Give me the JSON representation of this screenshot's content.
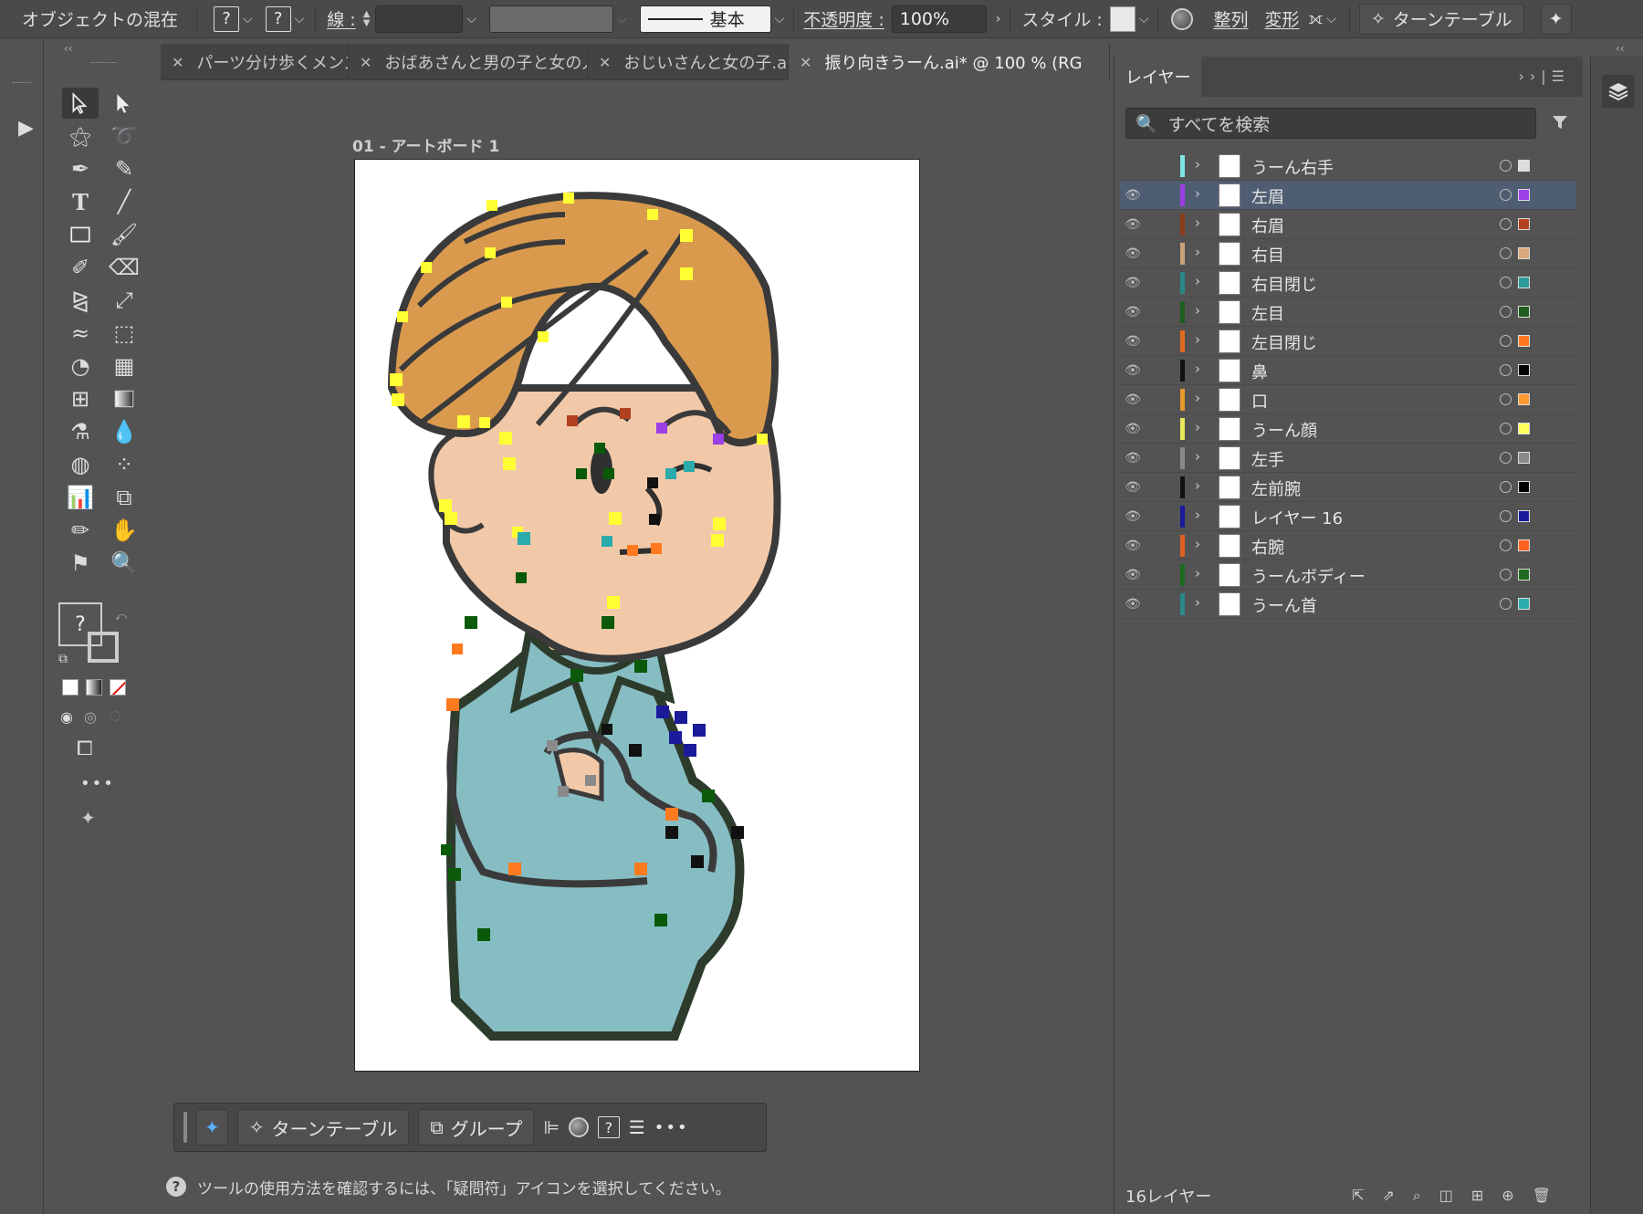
{
  "control_bar": {
    "title": "オブジェクトの混在",
    "q1": "?",
    "q2": "?",
    "stroke_label": "線 :",
    "stroke_style": "基本",
    "opacity_label": "不透明度 :",
    "opacity_value": "100%",
    "style_label": "スタイル :",
    "align_label": "整列",
    "transform_label": "変形",
    "turntable_button": "ターンテーブル"
  },
  "tabs": [
    {
      "label": "パーツ分け歩くメンズ.ai*"
    },
    {
      "label": "おばあさんと男の子と女の人.ai"
    },
    {
      "label": "おじいさんと女の子.ai"
    },
    {
      "label": "振り向きうーん.ai* @ 100 % (RG"
    }
  ],
  "artboard": {
    "name": "01 - アートボード 1"
  },
  "toolbar": {
    "fill_stroke_question": "?",
    "more": "•••"
  },
  "context_bar": {
    "turntable": "ターンテーブル",
    "group": "グループ",
    "question": "?",
    "more": "•••"
  },
  "status": {
    "icon": "?",
    "text": "ツールの使用方法を確認するには、「疑問符」アイコンを選択してください。"
  },
  "layers_panel": {
    "tab": "レイヤー",
    "search_placeholder": "すべてを検索",
    "footer_count": "16レイヤー",
    "layers": [
      {
        "name": "うーん右手",
        "color": "#7fe6e6",
        "visible": false,
        "selected": false,
        "sq": "#dddddd"
      },
      {
        "name": "左眉",
        "color": "#9b3fe6",
        "visible": true,
        "selected": true,
        "sq": "#9b3fe6"
      },
      {
        "name": "右眉",
        "color": "#8b3a1a",
        "visible": true,
        "selected": false,
        "sq": "#b0401f"
      },
      {
        "name": "右目",
        "color": "#c9a27a",
        "visible": true,
        "selected": false,
        "sq": "#d9a97a"
      },
      {
        "name": "右目閉じ",
        "color": "#2a8a8a",
        "visible": true,
        "selected": false,
        "sq": "#2a9a9a"
      },
      {
        "name": "左目",
        "color": "#1e5e1e",
        "visible": true,
        "selected": false,
        "sq": "#1e5e1e"
      },
      {
        "name": "左目閉じ",
        "color": "#e06a1e",
        "visible": true,
        "selected": false,
        "sq": "#ff7a1e"
      },
      {
        "name": "鼻",
        "color": "#111111",
        "visible": true,
        "selected": false,
        "sq": "#000000"
      },
      {
        "name": "口",
        "color": "#e89a2e",
        "visible": true,
        "selected": false,
        "sq": "#ff9a2e"
      },
      {
        "name": "うーん顔",
        "color": "#e8e85a",
        "visible": true,
        "selected": false,
        "sq": "#ffff5a"
      },
      {
        "name": "左手",
        "color": "#8a8a8a",
        "visible": true,
        "selected": false,
        "sq": "#8a8a8a"
      },
      {
        "name": "左前腕",
        "color": "#111111",
        "visible": true,
        "selected": false,
        "sq": "#000000"
      },
      {
        "name": "レイヤー 16",
        "color": "#1a1a9a",
        "visible": true,
        "selected": false,
        "sq": "#1a1a9a"
      },
      {
        "name": "右腕",
        "color": "#e0621e",
        "visible": true,
        "selected": false,
        "sq": "#ff621e"
      },
      {
        "name": "うーんボディー",
        "color": "#1e6a1e",
        "visible": true,
        "selected": false,
        "sq": "#1e6a1e"
      },
      {
        "name": "うーん首",
        "color": "#2a8a8a",
        "visible": true,
        "selected": false,
        "sq": "#2aaaaa"
      }
    ]
  }
}
